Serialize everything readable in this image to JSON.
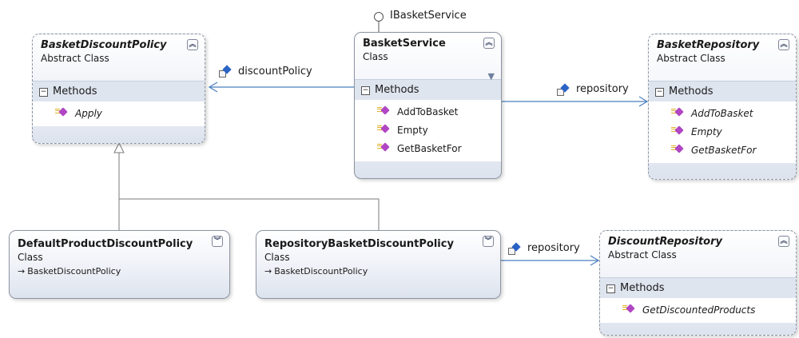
{
  "interface": {
    "name": "IBasketService"
  },
  "classes": {
    "basket_discount_policy": {
      "name": "BasketDiscountPolicy",
      "kind": "Abstract Class",
      "section": "Methods",
      "methods": [
        "Apply"
      ]
    },
    "basket_service": {
      "name": "BasketService",
      "kind": "Class",
      "section": "Methods",
      "methods": [
        "AddToBasket",
        "Empty",
        "GetBasketFor"
      ]
    },
    "basket_repository": {
      "name": "BasketRepository",
      "kind": "Abstract Class",
      "section": "Methods",
      "methods": [
        "AddToBasket",
        "Empty",
        "GetBasketFor"
      ]
    },
    "default_product_discount_policy": {
      "name": "DefaultProductDiscountPolicy",
      "kind": "Class",
      "base": "BasketDiscountPolicy"
    },
    "repository_basket_discount_policy": {
      "name": "RepositoryBasketDiscountPolicy",
      "kind": "Class",
      "base": "BasketDiscountPolicy"
    },
    "discount_repository": {
      "name": "DiscountRepository",
      "kind": "Abstract Class",
      "section": "Methods",
      "methods": [
        "GetDiscountedProducts"
      ]
    }
  },
  "associations": {
    "discount_policy": "discountPolicy",
    "repository_top": "repository",
    "repository_bottom": "repository"
  },
  "icons": {
    "collapse": "double-chevron-up-icon",
    "expand": "double-chevron-down-icon",
    "filter": "filter-icon",
    "method": "method-icon",
    "association": "association-icon",
    "inheritance": "inherits-arrow-icon"
  },
  "colors": {
    "connector": "#4a7fbf",
    "inheritance_line": "#7a7a7a",
    "method_icon": "#b046c4",
    "association_icon": "#2a63c6"
  }
}
